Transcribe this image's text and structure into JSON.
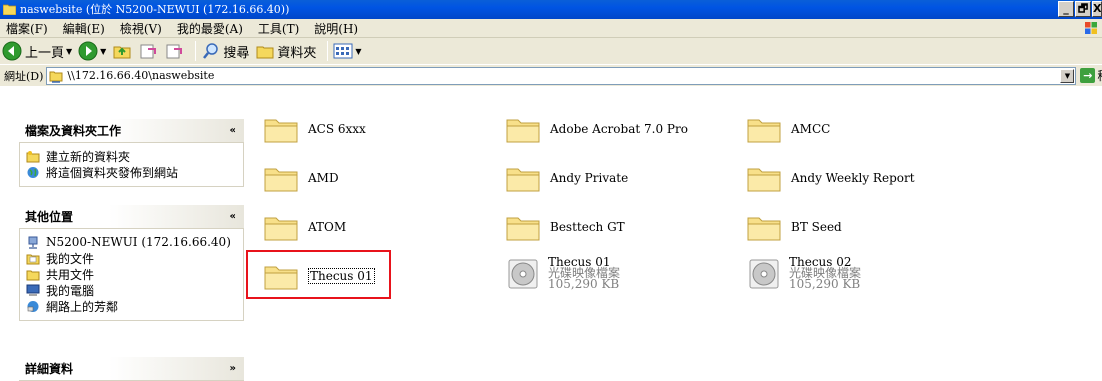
{
  "window": {
    "title": "naswebsite (位於 N5200-NEWUI (172.16.66.40))",
    "buttons": {
      "minimize": "_",
      "maximize": "🗗",
      "close": "X"
    }
  },
  "menu": [
    "檔案(F)",
    "編輯(E)",
    "檢視(V)",
    "我的最愛(A)",
    "工具(T)",
    "說明(H)"
  ],
  "toolbar": {
    "back_label": "上一頁",
    "search_label": "搜尋",
    "folders_label": "資料夾"
  },
  "address": {
    "label": "網址(D)",
    "value": "\\\\172.16.66.40\\naswebsite",
    "go_label": "移至"
  },
  "taskpane": {
    "file_tasks": {
      "title": "檔案及資料夾工作",
      "items": [
        "建立新的資料夾",
        "將這個資料夾發佈到網站"
      ]
    },
    "other_places": {
      "title": "其他位置",
      "items": [
        "N5200-NEWUI (172.16.66.40)",
        "我的文件",
        "共用文件",
        "我的電腦",
        "網路上的芳鄰"
      ]
    },
    "details": {
      "title": "詳細資料"
    }
  },
  "files": [
    {
      "name": "ACS 6xxx",
      "kind": "folder"
    },
    {
      "name": "Adobe Acrobat 7.0 Pro",
      "kind": "folder"
    },
    {
      "name": "AMCC",
      "kind": "folder"
    },
    {
      "name": "AMD",
      "kind": "folder"
    },
    {
      "name": "Andy Private",
      "kind": "folder"
    },
    {
      "name": "Andy Weekly Report",
      "kind": "folder"
    },
    {
      "name": "ATOM",
      "kind": "folder"
    },
    {
      "name": "Besttech GT",
      "kind": "folder"
    },
    {
      "name": "BT Seed",
      "kind": "folder"
    },
    {
      "name": "Thecus 01",
      "kind": "folder",
      "selected": true
    },
    {
      "name": "Thecus 01",
      "kind": "disc-image",
      "type": "光碟映像檔案",
      "size": "105,290 KB"
    },
    {
      "name": "Thecus 02",
      "kind": "disc-image",
      "type": "光碟映像檔案",
      "size": "105,290 KB"
    }
  ],
  "colors": {
    "titlebar": "#0054e3",
    "chrome": "#ece9d8",
    "highlight": "#e8131b"
  }
}
